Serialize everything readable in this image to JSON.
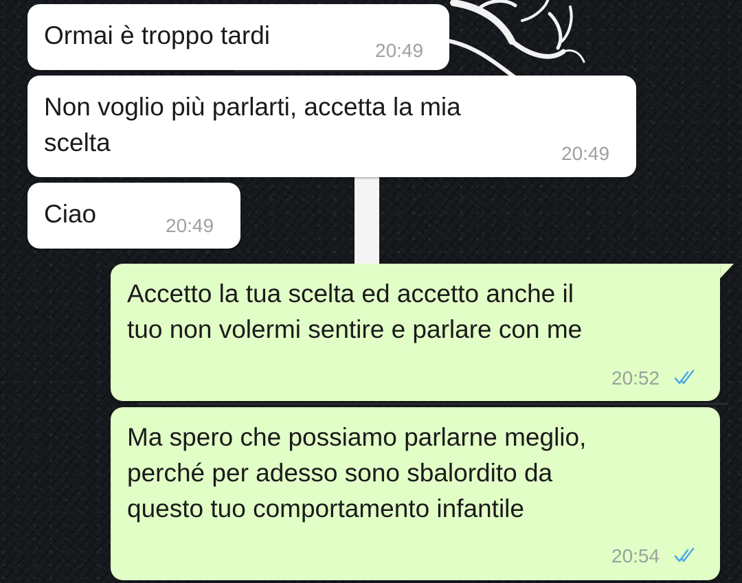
{
  "chat": {
    "messages": [
      {
        "direction": "incoming",
        "text": "Ormai è troppo tardi",
        "time": "20:49"
      },
      {
        "direction": "incoming",
        "text": "Non voglio più parlarti, accetta la mia\nscelta",
        "time": "20:49"
      },
      {
        "direction": "incoming",
        "text": "Ciao",
        "time": "20:49"
      },
      {
        "direction": "outgoing",
        "text": "Accetto la tua scelta ed accetto anche il\ntuo non volermi sentire e parlare con me",
        "time": "20:52",
        "status": "read"
      },
      {
        "direction": "outgoing",
        "text": "Ma spero che possiamo parlarne meglio,\nperché per adesso sono sbalordito da\nquesto tuo comportamento infantile",
        "time": "20:54",
        "status": "read"
      }
    ]
  },
  "colors": {
    "incoming_bubble": "#ffffff",
    "outgoing_bubble": "#e1fec7",
    "read_ticks": "#4fa9e6",
    "wallpaper": "#15181c"
  },
  "icons": {
    "read_receipt": "double-check-icon"
  }
}
